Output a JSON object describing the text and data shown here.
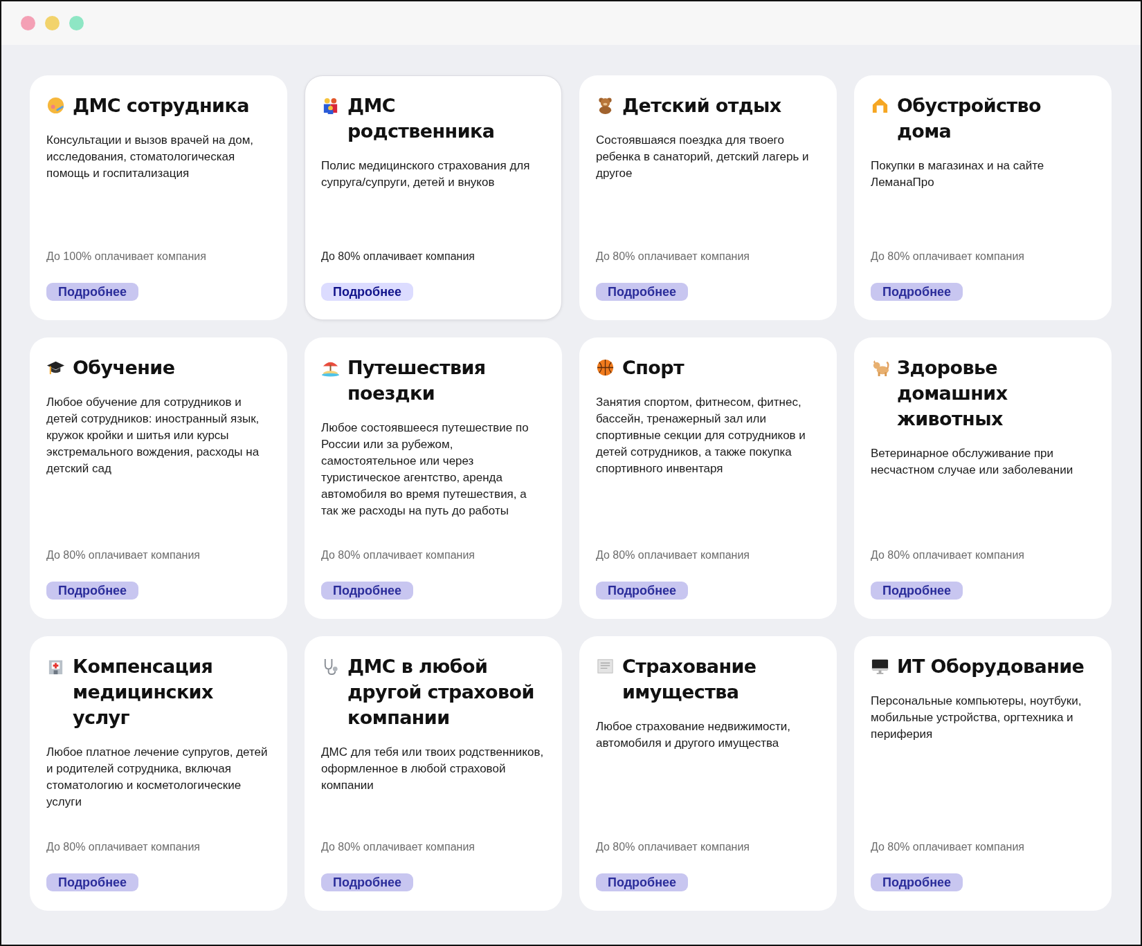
{
  "window": {
    "controls": [
      {
        "color": "#f4a0b5"
      },
      {
        "color": "#f2d36b"
      },
      {
        "color": "#8ee6c4"
      }
    ]
  },
  "cards": [
    {
      "title": "ДМС сотрудника",
      "description": "Консультации и вызов врачей на дом, исследования, стоматологическая помощь и госпитализация",
      "coverage": "До 100% оплачивает компания",
      "button": "Подробнее",
      "hovered": false
    },
    {
      "title": "ДМС родственника",
      "description": "Полис медицинского страхования для супруга/супруги, детей и внуков",
      "coverage": "До 80% оплачивает компания",
      "button": "Подробнее",
      "hovered": true
    },
    {
      "title": "Детский отдых",
      "description": "Состоявшаяся поездка для твоего ребенка в санаторий, детский лагерь и другое",
      "coverage": "До 80% оплачивает компания",
      "button": "Подробнее",
      "hovered": false
    },
    {
      "title": "Обустройство дома",
      "description": "Покупки в магазинах и на сайте ЛеманаПро",
      "coverage": "До 80% оплачивает компания",
      "button": "Подробнее",
      "hovered": false
    },
    {
      "title": "Обучение",
      "description": "Любое обучение для сотрудников и детей сотрудников: иностранный язык, кружок кройки и шитья или курсы экстремального вождения, расходы на детский сад",
      "coverage": "До 80% оплачивает компания",
      "button": "Подробнее",
      "hovered": false
    },
    {
      "title": "Путешествия поездки",
      "description": "Любое состоявшееся путешествие по России или за рубежом, самостоятельное или через туристическое агентство, аренда автомобиля во время путешествия, а так же расходы на путь до работы",
      "coverage": "До 80% оплачивает компания",
      "button": "Подробнее",
      "hovered": false
    },
    {
      "title": "Спорт",
      "description": "Занятия спортом, фитнесом, фитнес, бассейн, тренажерный зал или спортивные секции для сотрудников и детей сотрудников, а также покупка спортивного инвентаря",
      "coverage": "До 80% оплачивает компания",
      "button": "Подробнее",
      "hovered": false
    },
    {
      "title": "Здоровье домашних животных",
      "description": "Ветеринарное обслуживание при несчастном случае или заболевании",
      "coverage": "До 80% оплачивает компания",
      "button": "Подробнее",
      "hovered": false
    },
    {
      "title": "Компенсация медицинских услуг",
      "description": "Любое платное лечение супругов, детей и родителей сотрудника, включая стоматологию и косметологические услуги",
      "coverage": "До 80% оплачивает компания",
      "button": "Подробнее",
      "hovered": false
    },
    {
      "title": "ДМС в любой другой страховой компании",
      "description": "ДМС для тебя или твоих родственников, оформленное в любой страховой компании",
      "coverage": "До 80% оплачивает компания",
      "button": "Подробнее",
      "hovered": false
    },
    {
      "title": "Страхование имущества",
      "description": "Любое страхование недвижимости, автомобиля и другого имущества",
      "coverage": "До 80% оплачивает компания",
      "button": "Подробнее",
      "hovered": false
    },
    {
      "title": "ИТ Оборудование",
      "description": "Персональные компьютеры, ноутбуки, мобильные устройства, оргтехника и периферия",
      "coverage": "До 80% оплачивает компания",
      "button": "Подробнее",
      "hovered": false
    }
  ]
}
